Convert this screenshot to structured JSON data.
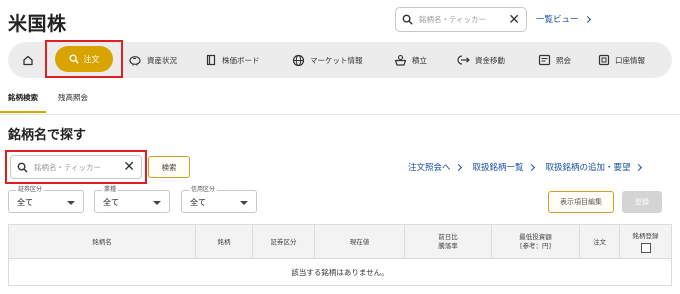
{
  "page": {
    "title": "米国株"
  },
  "top_search": {
    "placeholder": "銘柄名・ティッカー"
  },
  "list_view": {
    "label": "一覧ビュー"
  },
  "nav": {
    "items": [
      {
        "label": "",
        "icon": "home-icon"
      },
      {
        "label": "注文",
        "icon": "search-icon",
        "active": true
      },
      {
        "label": "資産状況",
        "icon": "piggy-bank-icon"
      },
      {
        "label": "株価ボード",
        "icon": "board-icon"
      },
      {
        "label": "マーケット情報",
        "icon": "globe-icon"
      },
      {
        "label": "積立",
        "icon": "savings-icon"
      },
      {
        "label": "資金移動",
        "icon": "transfer-icon"
      },
      {
        "label": "照会",
        "icon": "inquiry-icon"
      },
      {
        "label": "口座情報",
        "icon": "account-icon"
      }
    ]
  },
  "subtabs": [
    {
      "label": "銘柄検索",
      "active": true
    },
    {
      "label": "残高照会",
      "active": false
    }
  ],
  "section": {
    "title": "銘柄名で探す"
  },
  "main_search": {
    "placeholder": "銘柄名・ティッカー",
    "button": "検索"
  },
  "links": {
    "order_inquiry": "注文照会へ",
    "handled_list": "取扱銘柄一覧",
    "request": "取扱銘柄の追加・要望"
  },
  "filters": [
    {
      "label": "証券区分",
      "value": "全て"
    },
    {
      "label": "業種",
      "value": "全て"
    },
    {
      "label": "信用区分",
      "value": "全て"
    }
  ],
  "buttons": {
    "display_edit": "表示項目編集",
    "register": "登録"
  },
  "table": {
    "headers": {
      "name": "銘柄名",
      "code": "銘柄",
      "category": "証券区分",
      "price": "現在値",
      "change_line1": "前日比",
      "change_line2": "騰落率",
      "min_line1": "最低投資額",
      "min_line2": "[参考：円]",
      "order": "注文",
      "register": "銘柄登録"
    },
    "empty_message": "該当する銘柄はありません。"
  },
  "colors": {
    "accent": "#d9a400",
    "link": "#1a4fa0",
    "highlight": "#e02020"
  }
}
